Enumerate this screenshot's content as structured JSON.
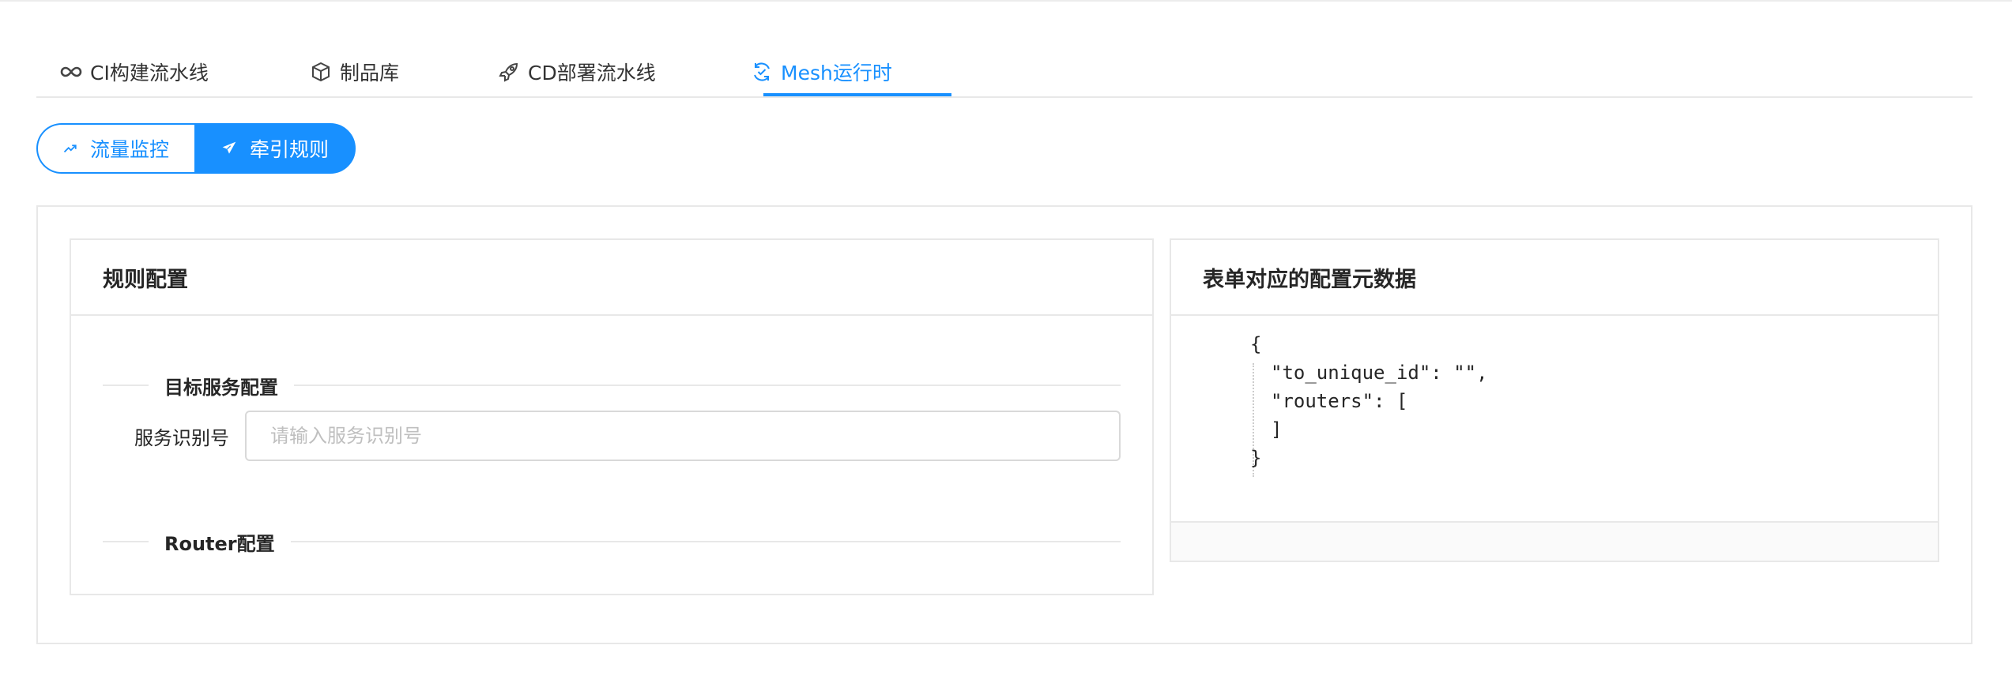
{
  "tabs": [
    {
      "label": "CI构建流水线",
      "icon": "infinity-icon"
    },
    {
      "label": "制品库",
      "icon": "box-icon"
    },
    {
      "label": "CD部署流水线",
      "icon": "rocket-icon"
    },
    {
      "label": "Mesh运行时",
      "icon": "sync-check-icon",
      "active": true
    }
  ],
  "segmented": [
    {
      "label": "流量监控",
      "icon": "trend-line-icon"
    },
    {
      "label": "牵引规则",
      "icon": "send-icon",
      "selected": true
    }
  ],
  "rule_config": {
    "title": "规则配置",
    "target_section": "目标服务配置",
    "service_id_label": "服务识别号",
    "service_id_placeholder": "请输入服务识别号",
    "service_id_value": "",
    "router_section": "Router配置"
  },
  "metadata": {
    "title": "表单对应的配置元数据",
    "json_lines": [
      "{",
      "\"to_unique_id\": \"\",",
      "\"routers\": [",
      "]",
      "}"
    ]
  },
  "colors": {
    "accent": "#1890ff",
    "border": "#e8e8e8"
  }
}
